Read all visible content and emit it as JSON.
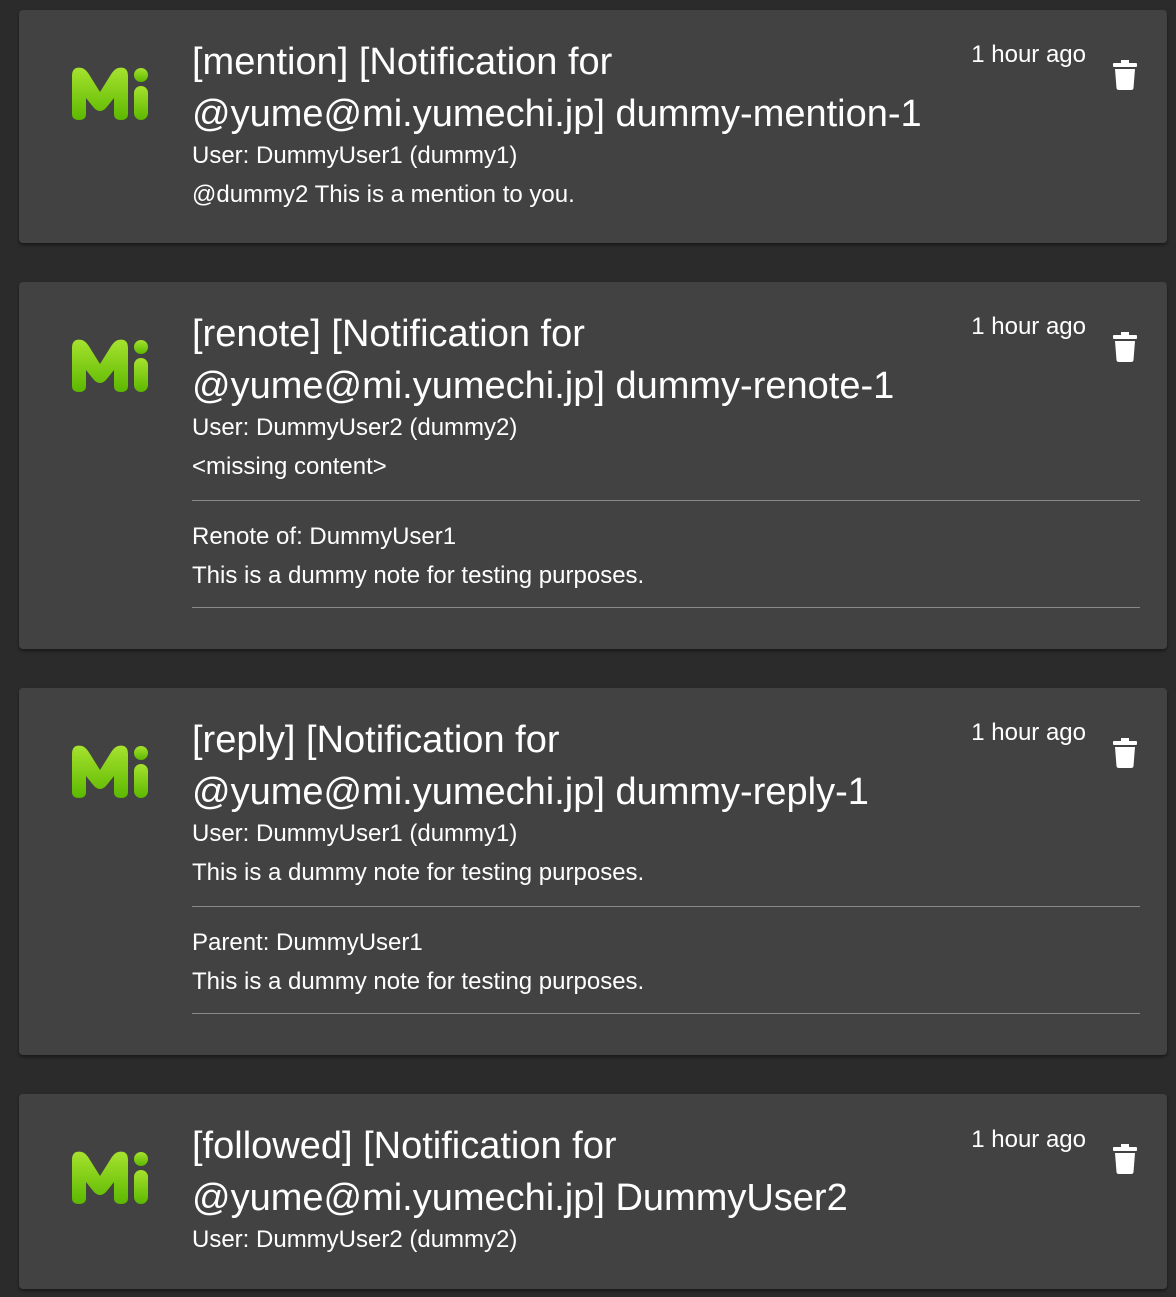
{
  "colors": {
    "background": "#2b2b2b",
    "card": "#424242",
    "logo_light": "#a6e22e",
    "logo_dark": "#5cb800",
    "text": "#ffffff",
    "divider": "#8a8a8a"
  },
  "icons": {
    "logo": "misskey-mi-logo",
    "delete": "trash-icon"
  },
  "notifications": [
    {
      "title": "[mention] [Notification for @yume@mi.yumechi.jp] dummy-mention-1",
      "time": "1 hour ago",
      "user": "User: DummyUser1 (dummy1)",
      "content": "@dummy2 This is a mention to you."
    },
    {
      "title": "[renote] [Notification for @yume@mi.yumechi.jp] dummy-renote-1",
      "time": "1 hour ago",
      "user": "User: DummyUser2 (dummy2)",
      "content": "<missing content>",
      "quote_header": "Renote of: DummyUser1",
      "quote_content": "This is a dummy note for testing purposes."
    },
    {
      "title": "[reply] [Notification for @yume@mi.yumechi.jp] dummy-reply-1",
      "time": "1 hour ago",
      "user": "User: DummyUser1 (dummy1)",
      "content": "This is a dummy note for testing purposes.",
      "quote_header": "Parent: DummyUser1",
      "quote_content": "This is a dummy note for testing purposes."
    },
    {
      "title": "[followed] [Notification for @yume@mi.yumechi.jp] DummyUser2",
      "time": "1 hour ago",
      "user": "User: DummyUser2 (dummy2)"
    }
  ]
}
